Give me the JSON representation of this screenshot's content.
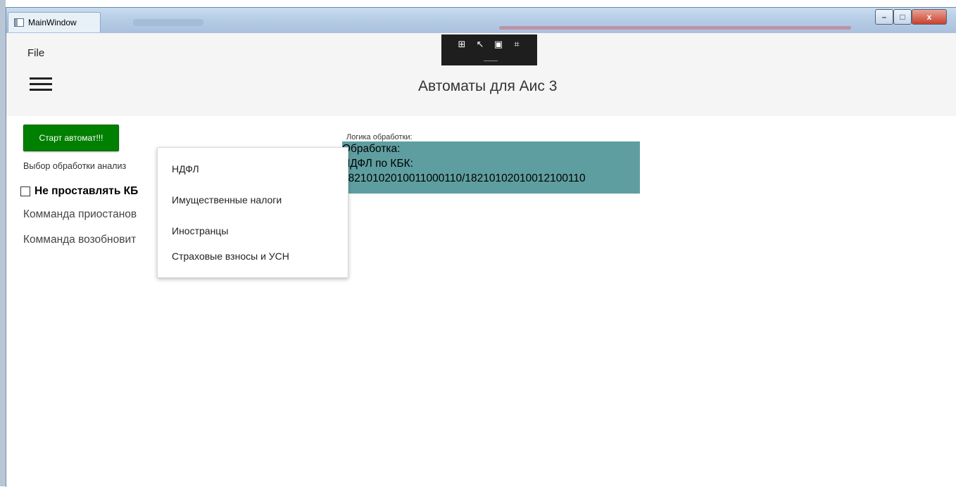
{
  "window": {
    "title": "MainWindow",
    "controls": {
      "minimize": "–",
      "maximize": "□",
      "close": "x"
    }
  },
  "menu": {
    "file": "File"
  },
  "header": {
    "title": "Автоматы для Аис 3"
  },
  "debug_toolbar": {
    "icons": [
      "select-element-icon",
      "pointer-icon",
      "layout-box-icon",
      "track-focus-icon"
    ]
  },
  "left_panel": {
    "start_button": "Старт автомат!!!",
    "choice_label": "Выбор обработки анализ",
    "checkbox_label": "Не проставлять КБ",
    "checkbox_checked": false,
    "cmd_pause": "Комманда приостанов",
    "cmd_resume": "Комманда возобновит"
  },
  "logic": {
    "label": "Логика обработки:",
    "lines": [
      "Обработка:",
      "НДФЛ по КБК:",
      "18210102010011000110/18210102010012100110"
    ],
    "bg_color": "#5F9EA0"
  },
  "dropdown": {
    "items": [
      "НДФЛ",
      "Имущественные налоги",
      "Иностранцы",
      "Страховые взносы и УСН"
    ]
  },
  "colors": {
    "start_button": "#008000"
  }
}
